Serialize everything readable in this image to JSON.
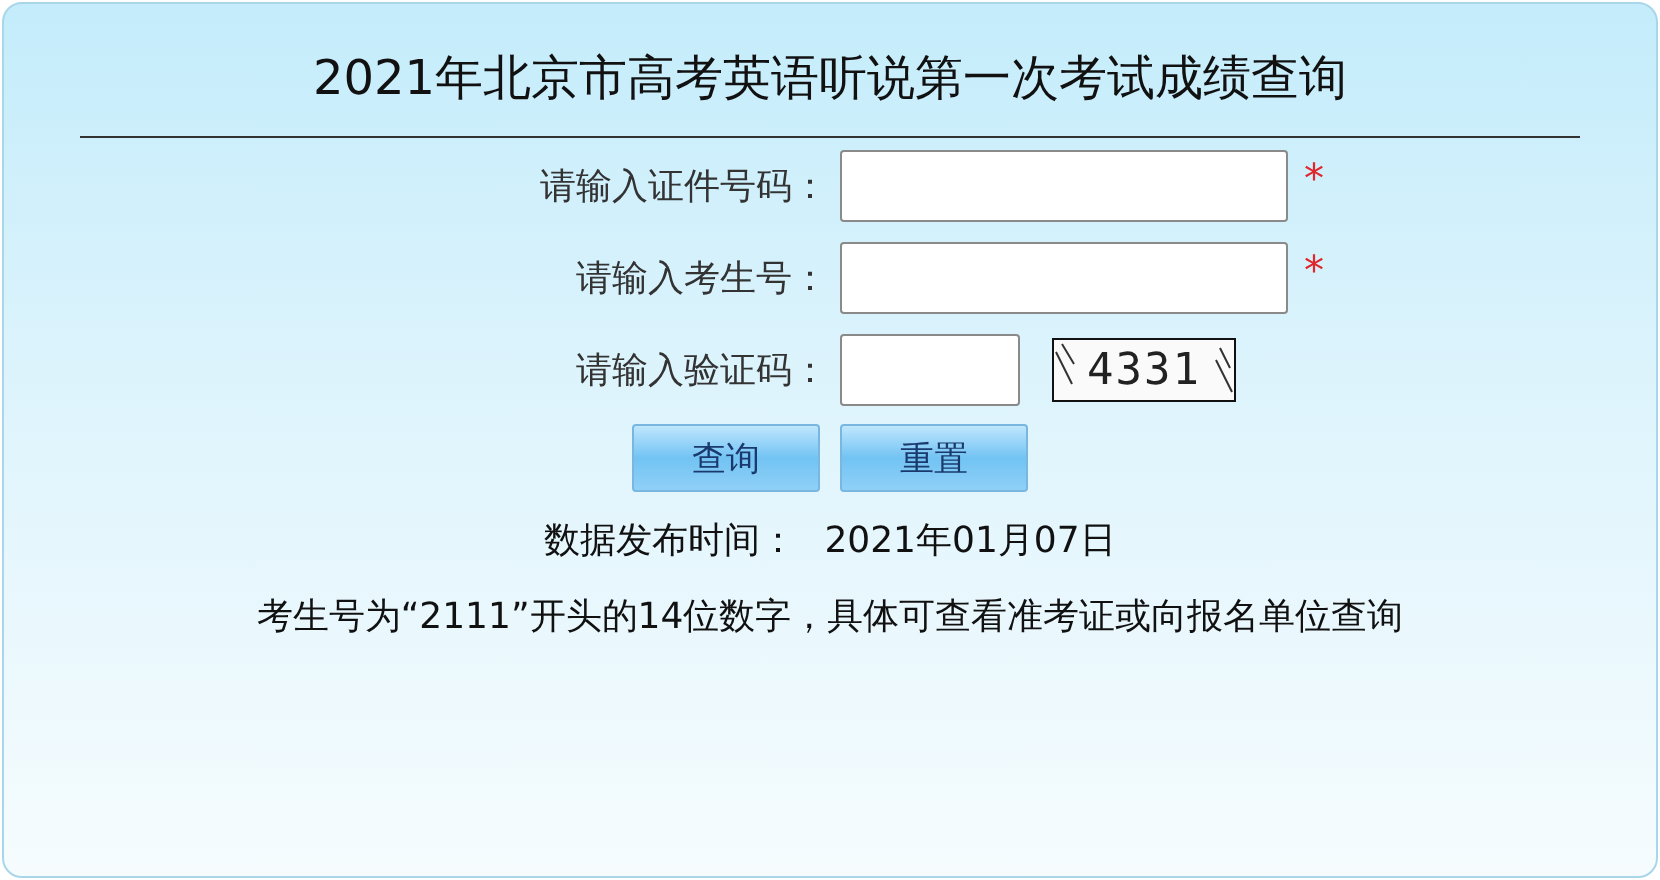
{
  "title": "2021年北京市高考英语听说第一次考试成绩查询",
  "fields": [
    {
      "label": "请输入证件号码：",
      "kind": "text",
      "required_mark": "*"
    },
    {
      "label": "请输入考生号：",
      "kind": "text",
      "required_mark": "*"
    },
    {
      "label": "请输入验证码：",
      "kind": "captcha",
      "captcha": "4331"
    }
  ],
  "buttons": [
    "查询",
    "重置"
  ],
  "release": {
    "label": "数据发布时间：",
    "date": "2021年01月07日"
  },
  "notice": "考生号为“2111”开头的14位数字，具体可查看准考证或向报名单位查询"
}
